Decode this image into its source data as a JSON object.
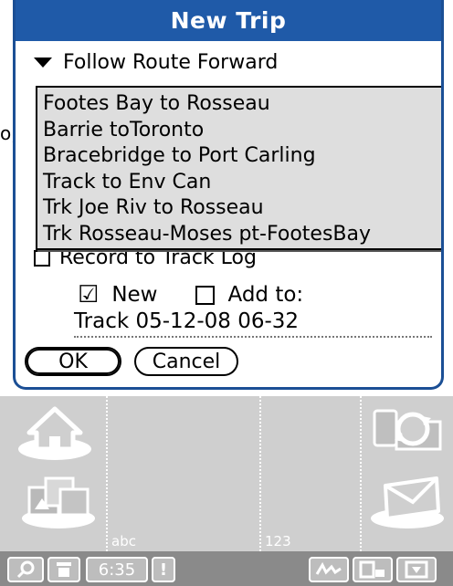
{
  "dialog": {
    "title": "New Trip",
    "route_mode": "Follow Route Forward",
    "record_label": "Record to Track Log",
    "new_label": "New",
    "add_to_label": "Add to:",
    "track_name": "Track 05-12-08 06-32",
    "ok_label": "OK",
    "cancel_label": "Cancel"
  },
  "route_list": {
    "items": [
      "Footes Bay to Rosseau",
      "Barrie toToronto",
      "Bracebridge to Port Carling",
      "Track to Env Can",
      "Trk Joe Riv to Rosseau",
      "Trk Rosseau-Moses pt-FootesBay"
    ]
  },
  "background": {
    "peek_text": "o,"
  },
  "graffiti": {
    "abc_label": "abc",
    "num_label": "123",
    "icons": [
      "home-icon",
      "applications-icon",
      "sync-icon",
      "mail-icon"
    ]
  },
  "status_bar": {
    "time": "6:35",
    "icons": [
      "find-icon",
      "menu-icon",
      "alert-icon",
      "graffiti-icon",
      "input-toggle-icon",
      "dismiss-icon"
    ]
  },
  "colors": {
    "title_bar": "#1f5aa8",
    "dialog_border": "#1b4f95",
    "list_background": "#dedede",
    "graffiti_background": "#cfcfcf",
    "status_bar_background": "#8a8a8a"
  }
}
